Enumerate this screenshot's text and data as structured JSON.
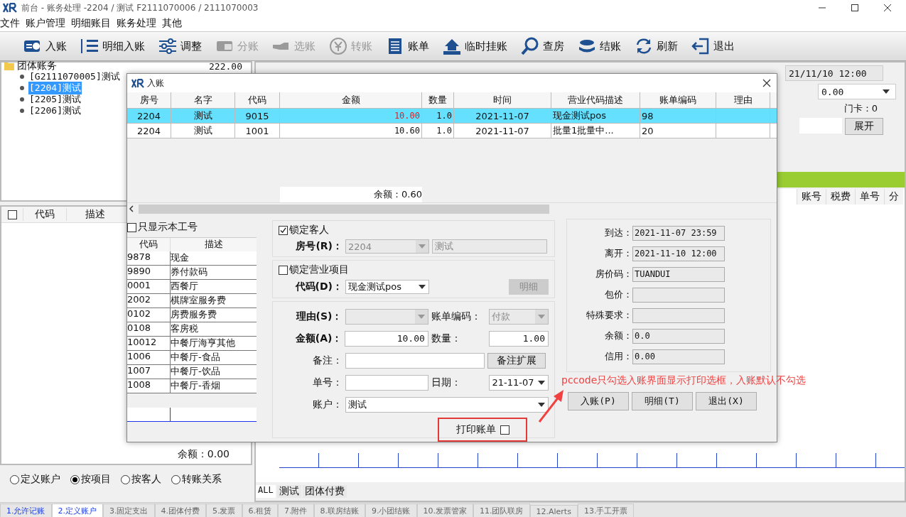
{
  "window": {
    "title": "前台 - 账务处理 -2204 / 测试 F2111070006 / 2111070003"
  },
  "menu": [
    "文件",
    "账户管理",
    "明细账目",
    "账务处理",
    "其他"
  ],
  "toolbar": [
    {
      "label": "入账",
      "disabled": false
    },
    {
      "label": "明细入账",
      "disabled": false
    },
    {
      "label": "调整",
      "disabled": false
    },
    {
      "label": "分账",
      "disabled": true
    },
    {
      "label": "选账",
      "disabled": true
    },
    {
      "label": "转账",
      "disabled": true
    },
    {
      "label": "账单",
      "disabled": false
    },
    {
      "label": "临时挂账",
      "disabled": false
    },
    {
      "label": "查房",
      "disabled": false
    },
    {
      "label": "结账",
      "disabled": false
    },
    {
      "label": "刷新",
      "disabled": false
    },
    {
      "label": "退出",
      "disabled": false
    }
  ],
  "tree": {
    "label": "团体账务",
    "amount": "222.00",
    "children": [
      {
        "label": "[G2111070005]测试",
        "selected": false
      },
      {
        "label": "[2204]测试",
        "selected": true
      },
      {
        "label": "[2205]测试",
        "selected": false
      },
      {
        "label": "[2206]测试",
        "selected": false
      }
    ]
  },
  "account_list": {
    "checked": false,
    "columns": [
      "代码",
      "描述"
    ],
    "balance": "余额：0.00"
  },
  "radios": [
    {
      "label": "定义账户",
      "selected": false
    },
    {
      "label": "按项目",
      "selected": true
    },
    {
      "label": "按客人",
      "selected": false
    },
    {
      "label": "转账关系",
      "selected": false
    }
  ],
  "guest_panel": {
    "departure": "21/11/10 12:00",
    "amount": "0.00",
    "room_card": "门卡：0",
    "expand_button": "展开"
  },
  "ledger": {
    "columns": [
      "账号",
      "税费",
      "单号",
      "分"
    ]
  },
  "filter_tabs": [
    {
      "label": "ALL",
      "selected": true
    },
    {
      "label": "测试",
      "selected": false
    },
    {
      "label": "团体付费",
      "selected": false
    }
  ],
  "bottom_tabs": [
    {
      "label": "1.允许记账",
      "selected": false,
      "highlighted": true
    },
    {
      "label": "2.定义账户",
      "selected": true,
      "highlighted": true
    },
    {
      "label": "3.固定支出",
      "selected": false,
      "highlighted": false
    },
    {
      "label": "4.团体付费",
      "selected": false,
      "highlighted": false
    },
    {
      "label": "5.发票",
      "selected": false,
      "highlighted": false
    },
    {
      "label": "6.租赁",
      "selected": false,
      "highlighted": false
    },
    {
      "label": "7.附件",
      "selected": false,
      "highlighted": false
    },
    {
      "label": "8.联房结账",
      "selected": false,
      "highlighted": false
    },
    {
      "label": "9.小团结账",
      "selected": false,
      "highlighted": false
    },
    {
      "label": "10.发票管家",
      "selected": false,
      "highlighted": false
    },
    {
      "label": "11.团队联房",
      "selected": false,
      "highlighted": false
    },
    {
      "label": "12.Alerts",
      "selected": false,
      "highlighted": false
    },
    {
      "label": "13.手工开票",
      "selected": false,
      "highlighted": false
    }
  ],
  "dialog": {
    "title": "入账",
    "columns": [
      "房号",
      "名字",
      "代码",
      "金额",
      "数量",
      "时间",
      "营业代码描述",
      "账单编码",
      "理由"
    ],
    "rows": [
      {
        "selected": true,
        "cells": [
          "2204",
          "测试",
          "9015",
          "10.00",
          "1.0",
          "2021-11-07",
          "现金测试pos",
          "98",
          ""
        ]
      },
      {
        "selected": false,
        "cells": [
          "2204",
          "测试",
          "1001",
          "10.60",
          "1.0",
          "2021-11-07",
          "批量1批量中...",
          "20",
          ""
        ]
      }
    ],
    "balance": "余额：0.60",
    "only_own": {
      "label": "只显示本工号",
      "checked": false
    },
    "code_columns": [
      "代码",
      "描述"
    ],
    "codes": [
      {
        "code": "9878",
        "desc": "现金"
      },
      {
        "code": "9890",
        "desc": "券付款码"
      },
      {
        "code": "0001",
        "desc": "西餐厅"
      },
      {
        "code": "2002",
        "desc": "棋牌室服务费"
      },
      {
        "code": "0102",
        "desc": "房费服务费"
      },
      {
        "code": "0108",
        "desc": "客房税"
      },
      {
        "code": "10012",
        "desc": "中餐厅海亨其他"
      },
      {
        "code": "1006",
        "desc": "中餐厅-食品"
      },
      {
        "code": "1007",
        "desc": "中餐厅-饮品"
      },
      {
        "code": "1008",
        "desc": "中餐厅-香烟"
      }
    ],
    "lock_guest": {
      "label": "锁定客人",
      "checked": true
    },
    "room": {
      "label": "房号(R)：",
      "value": "2204",
      "name": "测试",
      "disabled": true
    },
    "lock_item": {
      "label": "锁定营业项目",
      "checked": false
    },
    "code": {
      "label": "代码(D)：",
      "value": "现金测试pos",
      "detail_button": "明细",
      "detail_disabled": true
    },
    "reason": {
      "label": "理由(S)：",
      "disabled": true
    },
    "bill_code": {
      "label": "账单编码：",
      "value": "付款",
      "disabled": true
    },
    "amount": {
      "label": "金额(A)：",
      "value": "10.00"
    },
    "quantity": {
      "label": "数量：",
      "value": "1.00"
    },
    "remark": {
      "label": "备注：",
      "button": "备注扩展"
    },
    "number": {
      "label": "单号："
    },
    "date": {
      "label": "日期：",
      "value": "21-11-07"
    },
    "account": {
      "label": "账户：",
      "value": "测试"
    },
    "print": {
      "label": "打印账单",
      "checked": false
    },
    "info": [
      {
        "label": "到达：",
        "value": "2021-11-07 23:59"
      },
      {
        "label": "离开：",
        "value": "2021-11-10 12:00"
      },
      {
        "label": "房价码：",
        "value": "TUANDUI"
      },
      {
        "label": "包价："
      },
      {
        "label": "特殊要求："
      },
      {
        "label": "余额：",
        "value": "0.0"
      },
      {
        "label": "信用：",
        "value": "0.00"
      }
    ],
    "buttons": [
      "入账(P)",
      "明细(T)",
      "退出(X)"
    ]
  },
  "annotation": "pccode只勾选入账界面显示打印选框，入账默认不勾选"
}
